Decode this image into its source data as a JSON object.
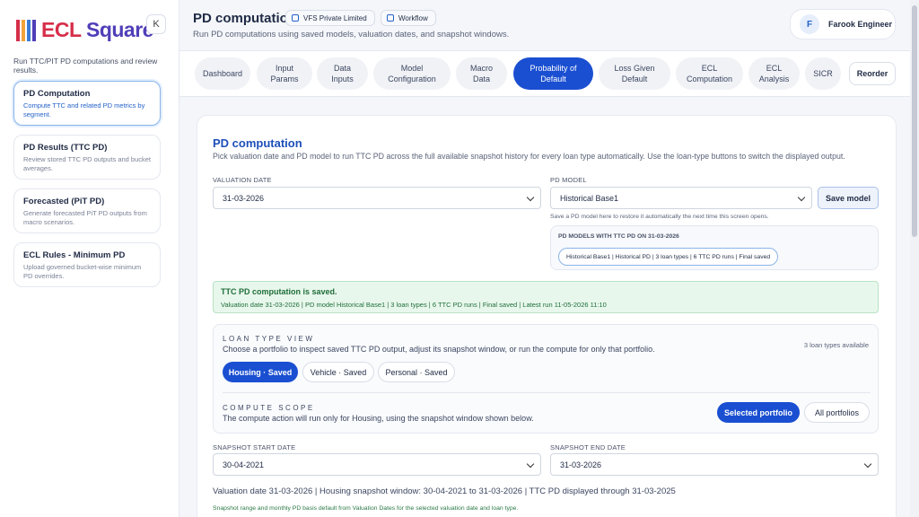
{
  "brand": {
    "part1": "ECL",
    "part2": "Square",
    "colors": [
      "#d62e4a",
      "#f2a33a",
      "#3a7bd5",
      "#4f3fb8"
    ]
  },
  "sidebar": {
    "collapse_label": "K",
    "subtitle": "Run TTC/PIT PD computations and review results.",
    "items": [
      {
        "title": "PD Computation",
        "desc": "Compute TTC and related PD metrics by segment."
      },
      {
        "title": "PD Results (TTC PD)",
        "desc": "Review stored TTC PD outputs and bucket averages."
      },
      {
        "title": "Forecasted (PiT PD)",
        "desc": "Generate forecasted PiT PD outputs from macro scenarios."
      },
      {
        "title": "ECL Rules - Minimum PD",
        "desc": "Upload governed bucket-wise minimum PD overrides."
      }
    ]
  },
  "header": {
    "title": "PD computation",
    "chip_company": "VFS Private Limited",
    "chip_workflow": "Workflow",
    "subtitle": "Run PD computations using saved models, valuation dates, and snapshot windows.",
    "user_initial": "F",
    "user_name": "Farook Engineer"
  },
  "tabs": [
    {
      "line1": "Dashboard",
      "line2": ""
    },
    {
      "line1": "Input",
      "line2": "Params"
    },
    {
      "line1": "Data",
      "line2": "Inputs"
    },
    {
      "line1": "Model",
      "line2": "Configuration"
    },
    {
      "line1": "Macro",
      "line2": "Data"
    },
    {
      "line1": "Probability of",
      "line2": "Default"
    },
    {
      "line1": "Loss Given",
      "line2": "Default"
    },
    {
      "line1": "ECL",
      "line2": "Computation"
    },
    {
      "line1": "ECL",
      "line2": "Analysis"
    },
    {
      "line1": "SICR",
      "line2": ""
    }
  ],
  "reorder_label": "Reorder",
  "main": {
    "title": "PD computation",
    "description": "Pick valuation date and PD model to run TTC PD across the full available snapshot history for every loan type automatically. Use the loan-type buttons to switch the displayed output.",
    "valuation_label": "VALUATION DATE",
    "valuation_value": "31-03-2026",
    "model_label": "PD MODEL",
    "model_value": "Historical Base1",
    "save_label": "Save model",
    "save_hint": "Save a PD model here to restore it automatically the next time this screen opens.",
    "models_title": "PD MODELS WITH TTC PD ON 31-03-2026",
    "model_pill": "Historical Base1 | Historical PD | 3 loan types | 6 TTC PD runs | Final saved",
    "saved_title": "TTC PD computation is saved.",
    "saved_detail": "Valuation date 31-03-2026 | PD model Historical Base1 | 3 loan types | 6 TTC PD runs | Final saved | Latest run 11-05-2026 11:10",
    "loan_view_title": "LOAN TYPE VIEW",
    "loan_view_desc": "Choose a portfolio to inspect saved TTC PD output, adjust its snapshot window, or run the compute for only that portfolio.",
    "loan_count": "3 loan types available",
    "loan_types": [
      "Housing · Saved",
      "Vehicle · Saved",
      "Personal · Saved"
    ],
    "scope_title": "COMPUTE SCOPE",
    "scope_desc": "The compute action will run only for Housing, using the snapshot window shown below.",
    "scope_selected": "Selected portfolio",
    "scope_all": "All portfolios",
    "start_label": "SNAPSHOT START DATE",
    "start_value": "30-04-2021",
    "end_label": "SNAPSHOT END DATE",
    "end_value": "31-03-2026",
    "summary": "Valuation date 31-03-2026 | Housing snapshot window: 30-04-2021 to 31-03-2026 | TTC PD displayed through 31-03-2025",
    "footnote": "Snapshot range and monthly PD basis default from Valuation Dates for the selected valuation date and loan type."
  }
}
